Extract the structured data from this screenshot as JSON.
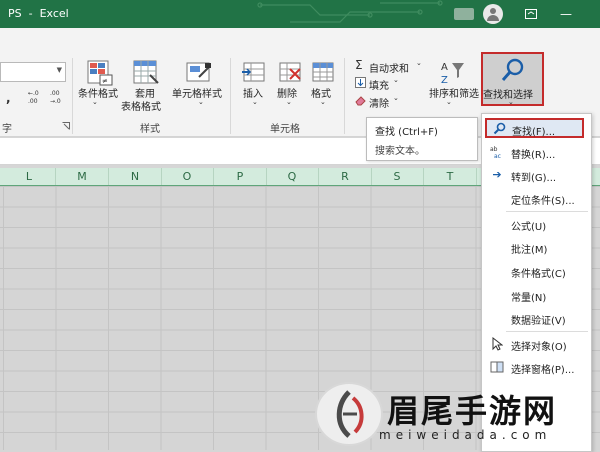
{
  "window": {
    "title": "PS  -  Excel",
    "minimize_label": "—",
    "close_label": "✕"
  },
  "ribbon": {
    "font_group_label": "字",
    "number_small": {
      "comma": ",",
      "inc": ".00\n→.0",
      "dec": ".00\n→.0"
    },
    "styles": {
      "conditional_format": "条件格式",
      "format_as_table_1": "套用",
      "format_as_table_2": "表格格式",
      "cell_styles": "单元格样式",
      "group_label": "样式"
    },
    "cells": {
      "insert": "插入",
      "delete": "删除",
      "format": "格式",
      "group_label": "单元格"
    },
    "editing": {
      "autosum": "自动求和",
      "fill": "填充",
      "clear": "清除",
      "sort_filter": "排序和筛选",
      "find_select": "查找和选择"
    }
  },
  "tooltip": {
    "title": "查找 (Ctrl+F)",
    "description": "搜索文本。"
  },
  "columns": [
    "L",
    "M",
    "N",
    "O",
    "P",
    "Q",
    "R",
    "S",
    "T"
  ],
  "menu": {
    "items": [
      {
        "label": "查找(F)...",
        "icon": "search-icon"
      },
      {
        "label": "替换(R)...",
        "icon": "replace-icon"
      },
      {
        "label": "转到(G)...",
        "icon": "arrow-right-icon"
      },
      {
        "label": "定位条件(S)...",
        "icon": ""
      },
      {
        "label": "公式(U)",
        "icon": ""
      },
      {
        "label": "批注(M)",
        "icon": ""
      },
      {
        "label": "条件格式(C)",
        "icon": ""
      },
      {
        "label": "常量(N)",
        "icon": ""
      },
      {
        "label": "数据验证(V)",
        "icon": ""
      },
      {
        "label": "选择对象(O)",
        "icon": "cursor-icon"
      },
      {
        "label": "选择窗格(P)...",
        "icon": "selection-pane-icon"
      }
    ]
  },
  "watermark": {
    "main": "眉尾手游网",
    "sub": "meiweidada.com"
  },
  "colors": {
    "excel_green": "#217346",
    "highlight_red": "#c42b2b",
    "accent_blue": "#1b5ea8"
  }
}
